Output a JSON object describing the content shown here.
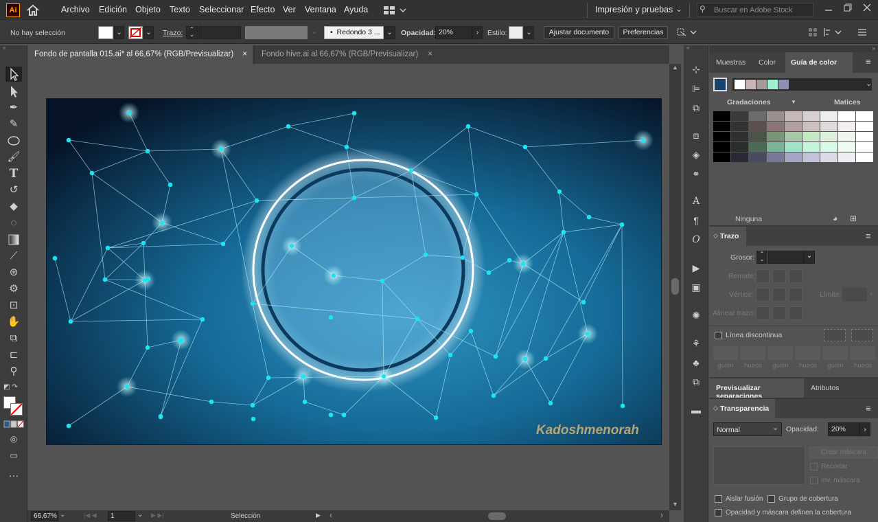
{
  "app": {
    "logo": "Ai",
    "workspace": "Impresión y pruebas",
    "search_placeholder": "Buscar en Adobe Stock"
  },
  "menu": [
    "Archivo",
    "Edición",
    "Objeto",
    "Texto",
    "Seleccionar",
    "Efecto",
    "Ver",
    "Ventana",
    "Ayuda"
  ],
  "options": {
    "selection": "No hay selección",
    "stroke_label": "Trazo:",
    "brush": "Redondo 3 ...",
    "opacity_label": "Opacidad:",
    "opacity_value": "20%",
    "style_label": "Estilo:",
    "fit_doc": "Ajustar documento",
    "prefs": "Preferencias"
  },
  "tabs": [
    {
      "label": "Fondo de pantalla 015.ai* al 66,67% (RGB/Previsualizar)",
      "close": "×"
    },
    {
      "label": "Fondo hive.ai al 66,67% (RGB/Previsualizar)",
      "close": "×"
    }
  ],
  "artwork": {
    "watermark": "Kadoshmenorah",
    "bg_inner": "#2d93bf",
    "bg_outer": "#061326",
    "node_color": "#19e6f2"
  },
  "status": {
    "zoom": "66,67%",
    "page": "1",
    "tool": "Selección"
  },
  "color_panel": {
    "tabs": [
      "Muestras",
      "Color",
      "Guía de color"
    ],
    "gradations": "Gradaciones",
    "hues": "Matices",
    "none": "Ninguna",
    "harmony": [
      "#ffffff",
      "#c8b4b4",
      "#a59a98",
      "#9ff0d2",
      "#8f8fb4"
    ],
    "grid_rows": [
      [
        "#000000",
        "#3a3a3a",
        "#6b6b6b",
        "#9b9090",
        "#c8b9b9",
        "#d8d0d0",
        "#eeeeee",
        "#ffffff",
        "#ffffff"
      ],
      [
        "#000000",
        "#333333",
        "#5a4e4e",
        "#8a7474",
        "#b4a0a0",
        "#cdbfbf",
        "#e2dada",
        "#f2eeee",
        "#ffffff"
      ],
      [
        "#000000",
        "#303030",
        "#4a5548",
        "#7a9478",
        "#a8c8a8",
        "#c4e8c4",
        "#dcf0dc",
        "#eef6ee",
        "#ffffff"
      ],
      [
        "#000000",
        "#2a2e2c",
        "#4c6a58",
        "#7ab498",
        "#a2e4c8",
        "#c4f4dc",
        "#dafaea",
        "#eefcf4",
        "#ffffff"
      ],
      [
        "#000000",
        "#2a2a34",
        "#4a4a60",
        "#787898",
        "#a6a6c4",
        "#c2c2d8",
        "#dadae6",
        "#eeeef4",
        "#ffffff"
      ]
    ]
  },
  "stroke_panel": {
    "title": "Trazo",
    "weight": "Grosor:",
    "cap": "Remate:",
    "corner": "Vértice:",
    "limit": "Límite:",
    "align": "Alinear trazo:",
    "dashed": "Línea discontinua",
    "dash_labels": [
      "guión",
      "hueco",
      "guión",
      "hueco",
      "guión",
      "hueco"
    ]
  },
  "sep_panel": {
    "tabs": [
      "Previsualizar separaciones",
      "Atributos"
    ]
  },
  "transp_panel": {
    "title": "Transparencia",
    "mode": "Normal",
    "opacity_label": "Opacidad:",
    "opacity_value": "20%",
    "mask_btn": "Crear máscara",
    "clip": "Recortar",
    "invert": "Inv. máscara",
    "isolate": "Aislar fusión",
    "knockout": "Grupo de cobertura",
    "opacity_mask": "Opacidad y máscara definen la cobertura"
  }
}
